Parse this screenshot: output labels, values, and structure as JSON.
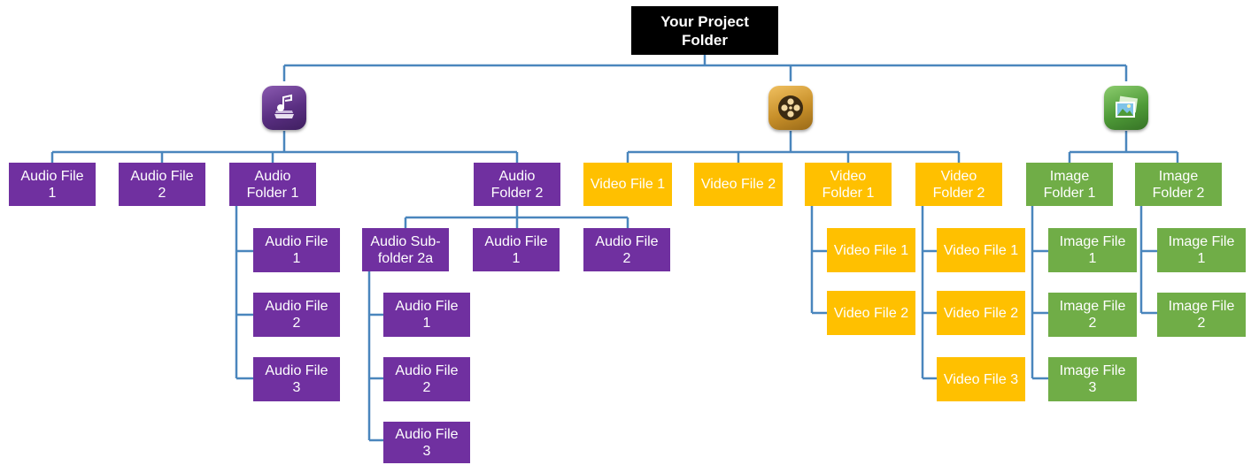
{
  "root": {
    "label": "Your Project\nFolder"
  },
  "icons": {
    "audio": "music-note-icon",
    "video": "film-reel-icon",
    "image": "picture-icon"
  },
  "colors": {
    "connector": "#4a86bd",
    "audio": "#7030a0",
    "video": "#ffc000",
    "image": "#70ad47",
    "root": "#000000"
  },
  "audio": {
    "file_1": "Audio File\n1",
    "file_2": "Audio File\n2",
    "folder_1": {
      "label": "Audio\nFolder 1",
      "files": [
        "Audio File\n1",
        "Audio File\n2",
        "Audio File\n3"
      ]
    },
    "folder_2": {
      "label": "Audio\nFolder 2",
      "subfolder_2a": {
        "label": "Audio Sub-\nfolder 2a",
        "files": [
          "Audio File\n1",
          "Audio File\n2",
          "Audio File\n3"
        ]
      },
      "file_1": "Audio File\n1",
      "file_2": "Audio File\n2"
    }
  },
  "video": {
    "file_1": "Video File 1",
    "file_2": "Video File 2",
    "folder_1": {
      "label": "Video\nFolder 1",
      "files": [
        "Video File 1",
        "Video File 2"
      ]
    },
    "folder_2": {
      "label": "Video\nFolder 2",
      "files": [
        "Video File 1",
        "Video File 2",
        "Video File 3"
      ]
    }
  },
  "image": {
    "folder_1": {
      "label": "Image\nFolder 1",
      "files": [
        "Image File\n1",
        "Image File\n2",
        "Image File\n3"
      ]
    },
    "folder_2": {
      "label": "Image\nFolder 2",
      "files": [
        "Image File\n1",
        "Image File\n2"
      ]
    }
  }
}
